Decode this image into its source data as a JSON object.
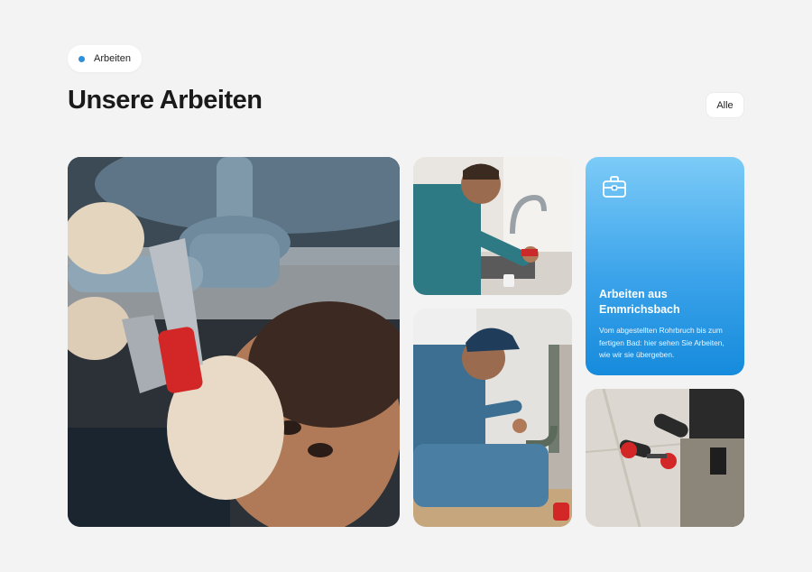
{
  "badge": {
    "label": "Arbeiten",
    "dot_color": "#2f8fd8"
  },
  "header": {
    "title": "Unsere Arbeiten",
    "all_button": "Alle"
  },
  "info_card": {
    "icon": "toolbox-icon",
    "heading": "Arbeiten aus Emmrichsbach",
    "text": "Vom abgestellten Rohrbruch bis zum fertigen Bad: hier sehen Sie Arbeiten, wie wir sie übergeben.",
    "gradient": [
      "#7ccbf7",
      "#168bdc"
    ]
  },
  "photos": [
    {
      "name": "plumber-wrench-photo"
    },
    {
      "name": "plumber-sink-faucet-photo"
    },
    {
      "name": "plumber-under-sink-photo"
    },
    {
      "name": "wall-tiling-photo"
    }
  ]
}
